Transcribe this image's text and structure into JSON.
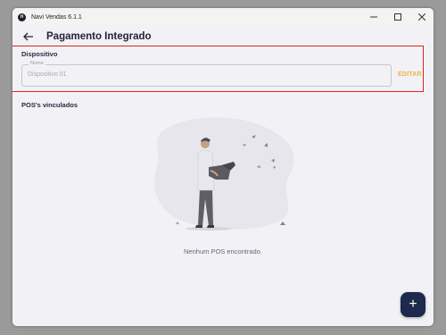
{
  "window": {
    "app_title": "Navi Vendas 6.1.1",
    "controls": [
      "minimize",
      "maximize",
      "close"
    ]
  },
  "appbar": {
    "title": "Pagamento Integrado",
    "back_icon": "arrow-left-icon"
  },
  "device_section": {
    "label": "Dispositivo",
    "field_label": "Nome",
    "field_value": "Dispositivo 01",
    "edit_label": "EDITAR"
  },
  "pos_section": {
    "label": "POS's vinculados",
    "empty_text": "Nenhum POS encontrado."
  },
  "fab": {
    "label": "+",
    "icon": "plus-icon"
  },
  "colors": {
    "accent": "#f0b43a",
    "primary": "#1d2a4d",
    "highlight": "#e02020"
  }
}
